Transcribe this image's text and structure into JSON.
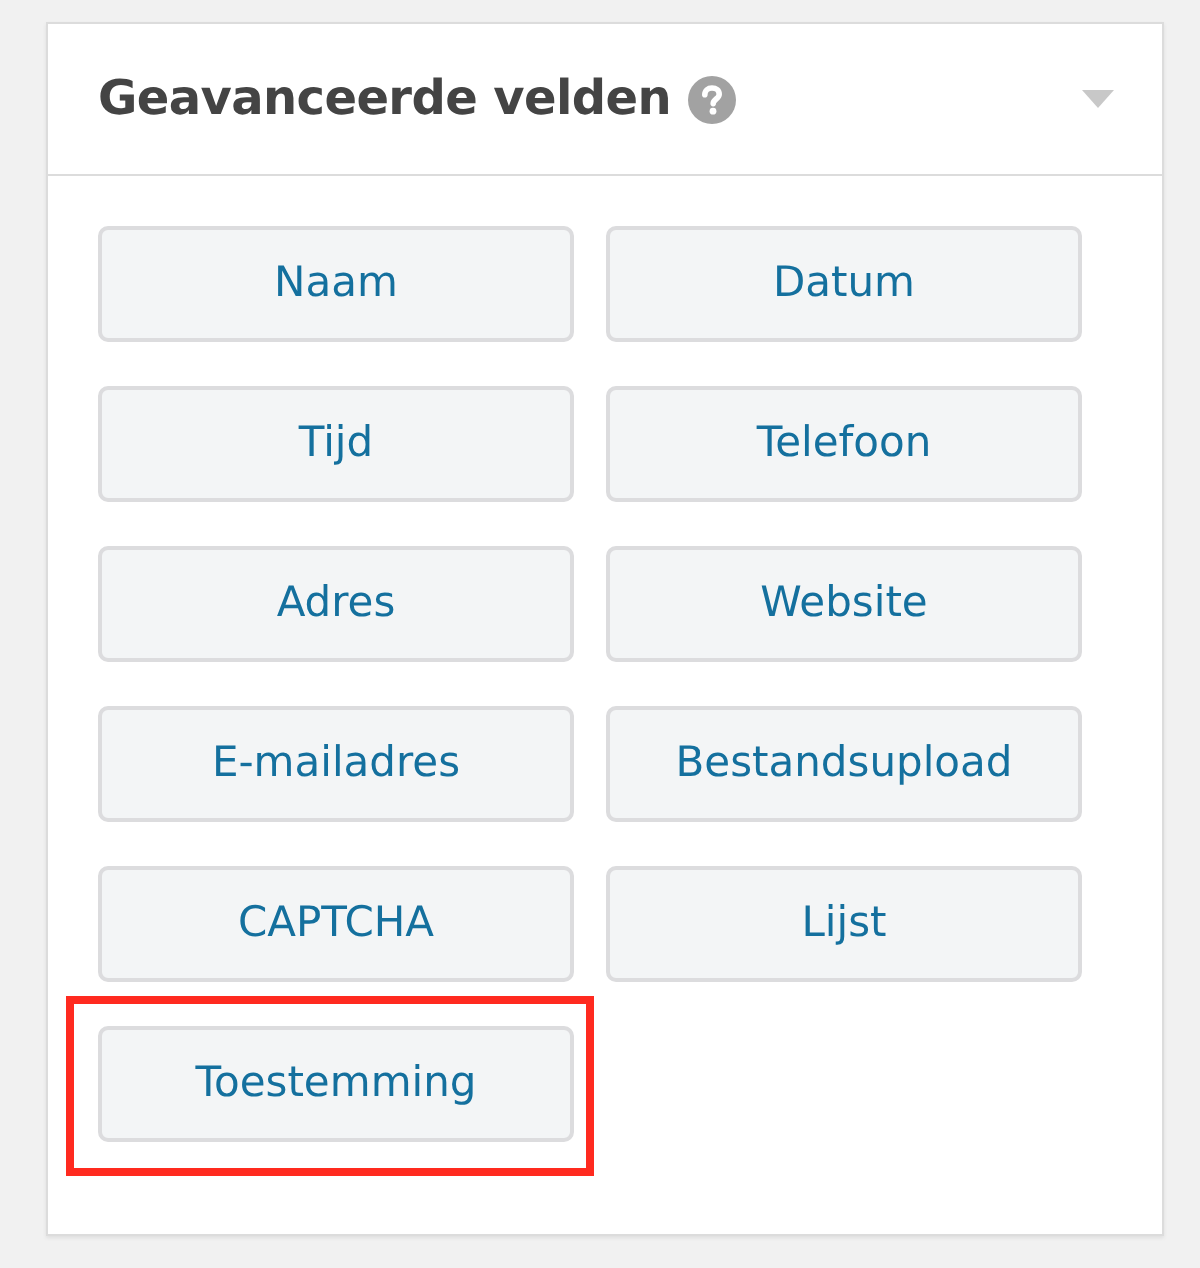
{
  "panel": {
    "title": "Geavanceerde velden"
  },
  "fields": [
    {
      "label": "Naam",
      "highlighted": false
    },
    {
      "label": "Datum",
      "highlighted": false
    },
    {
      "label": "Tijd",
      "highlighted": false
    },
    {
      "label": "Telefoon",
      "highlighted": false
    },
    {
      "label": "Adres",
      "highlighted": false
    },
    {
      "label": "Website",
      "highlighted": false
    },
    {
      "label": "E-mailadres",
      "highlighted": false
    },
    {
      "label": "Bestandsupload",
      "highlighted": false
    },
    {
      "label": "CAPTCHA",
      "highlighted": false
    },
    {
      "label": "Lijst",
      "highlighted": false
    },
    {
      "label": "Toestemming",
      "highlighted": true
    }
  ]
}
